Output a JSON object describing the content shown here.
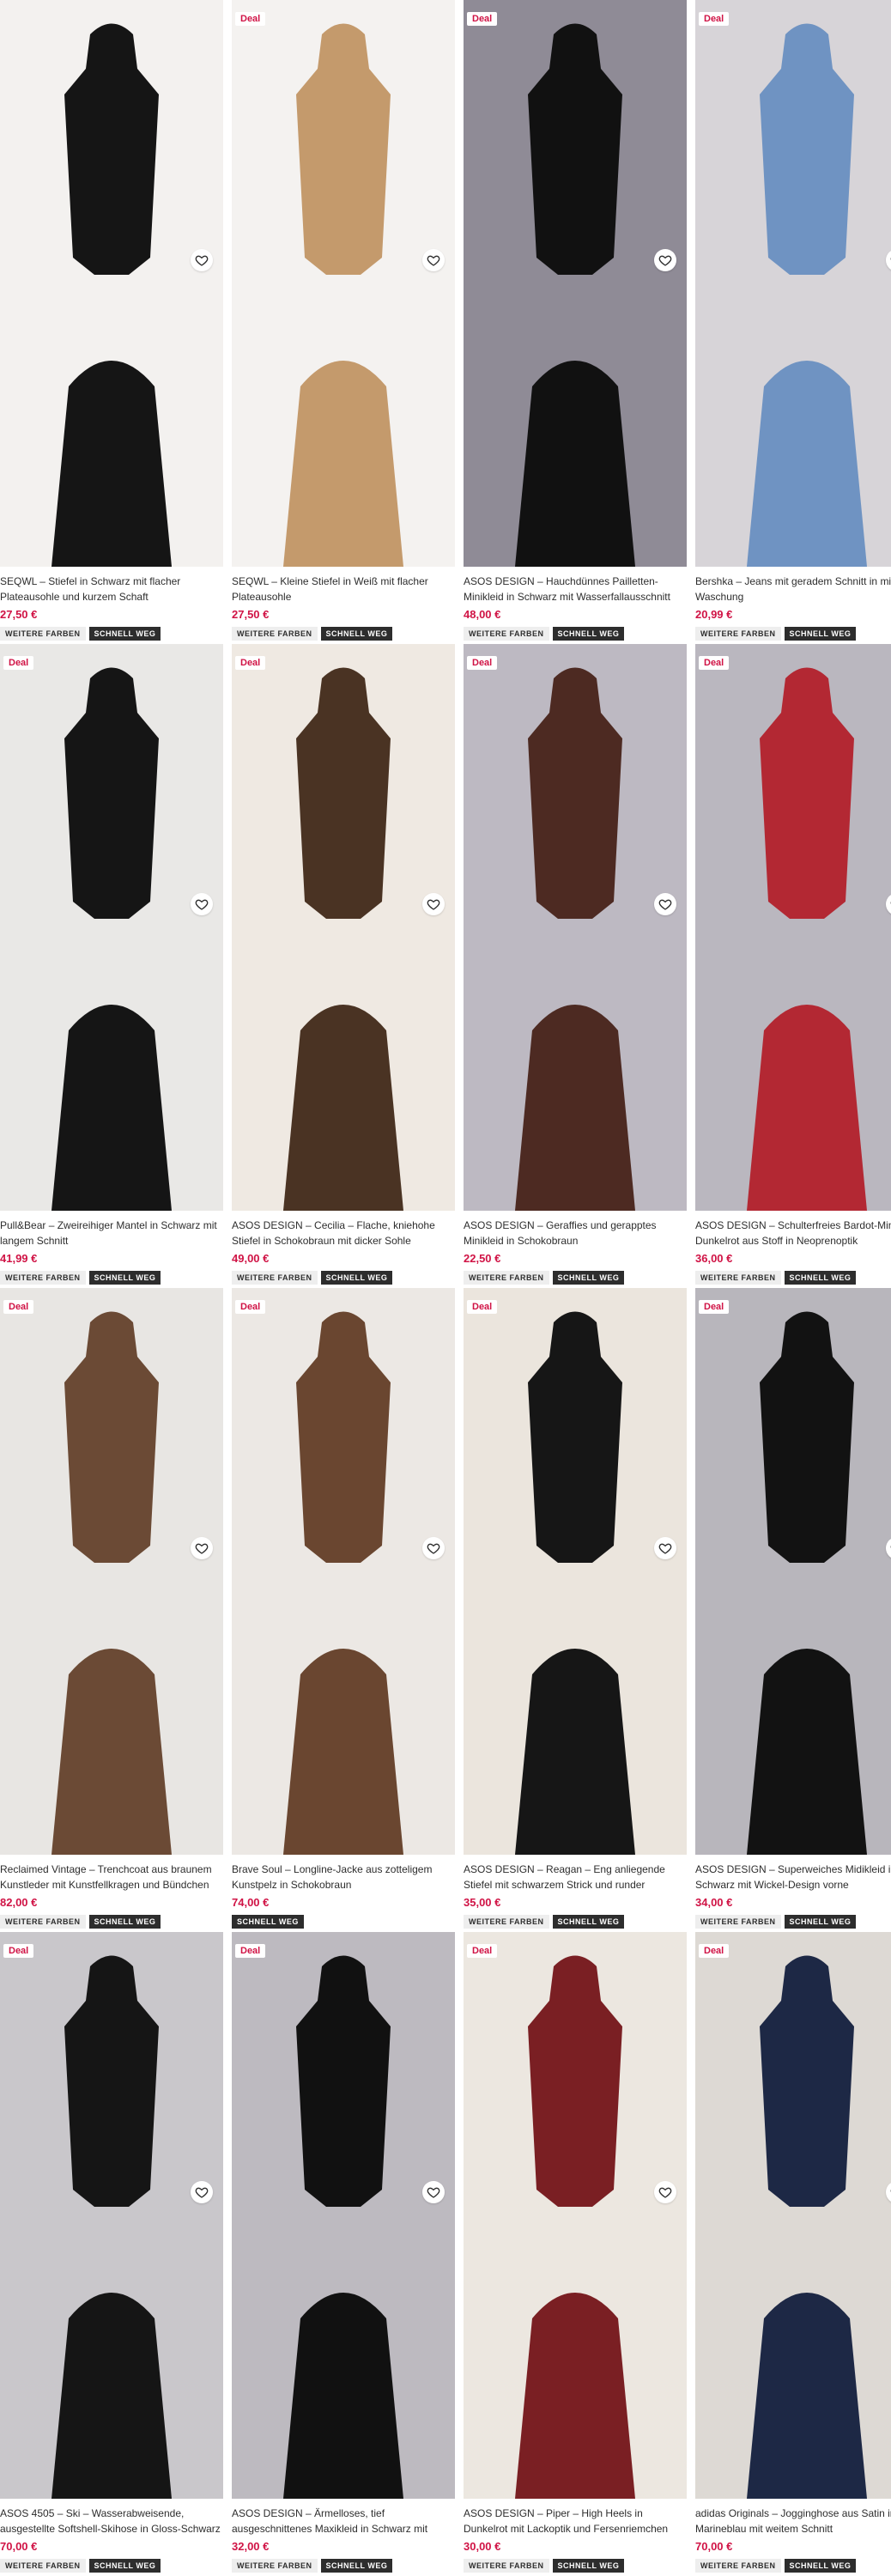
{
  "deal_label": "Deal",
  "products": [
    {
      "title": "SEQWL – Stiefel in Schwarz mit flacher Plateausohle und kurzem Schaft",
      "price": "27,50 €",
      "deal": false,
      "badges": [
        "WEITERE FARBEN",
        "SCHNELL WEG"
      ]
    },
    {
      "title": "SEQWL – Kleine Stiefel in Weiß mit flacher Plateausohle",
      "price": "27,50 €",
      "deal": true,
      "badges": [
        "WEITERE FARBEN",
        "SCHNELL WEG"
      ]
    },
    {
      "title": "ASOS DESIGN – Hauchdünnes Pailletten-Minikleid in Schwarz mit Wasserfallausschnitt und Riemchen-...",
      "price": "48,00 €",
      "deal": true,
      "badges": [
        "WEITERE FARBEN",
        "SCHNELL WEG"
      ]
    },
    {
      "title": "Bershka – Jeans mit geradem Schnitt in mittlerer Waschung",
      "price": "20,99 €",
      "deal": true,
      "badges": [
        "WEITERE FARBEN",
        "SCHNELL WEG"
      ]
    },
    {
      "title": "Pull&Bear – Zweireihiger Mantel in Schwarz mit langem Schnitt",
      "price": "41,99 €",
      "deal": true,
      "badges": [
        "WEITERE FARBEN",
        "SCHNELL WEG"
      ]
    },
    {
      "title": "ASOS DESIGN – Cecilia – Flache, kniehohe Stiefel in Schokobraun mit dicker Sohle",
      "price": "49,00 €",
      "deal": true,
      "badges": [
        "WEITERE FARBEN",
        "SCHNELL WEG"
      ]
    },
    {
      "title": "ASOS DESIGN – Geraffies und gerapptes Minikleid in Schokobraun",
      "price": "22,50 €",
      "deal": true,
      "badges": [
        "WEITERE FARBEN",
        "SCHNELL WEG"
      ]
    },
    {
      "title": "ASOS DESIGN – Schulterfreies Bardot-Minikleid Dunkelrot aus Stoff in Neoprenoptik",
      "price": "36,00 €",
      "deal": true,
      "badges": [
        "WEITERE FARBEN",
        "SCHNELL WEG"
      ]
    },
    {
      "title": "Reclaimed Vintage – Trenchcoat aus braunem Kunstleder mit Kunstfellkragen und Bündchen aus...",
      "price": "82,00 €",
      "deal": true,
      "badges": [
        "WEITERE FARBEN",
        "SCHNELL WEG"
      ]
    },
    {
      "title": "Brave Soul – Longline-Jacke aus zotteligem Kunstpelz in Schokobraun",
      "price": "74,00 €",
      "deal": true,
      "badges": [
        "SCHNELL WEG"
      ]
    },
    {
      "title": "ASOS DESIGN – Reagan – Eng anliegende Stiefel mit schwarzem Strick und runder Zehenpartie",
      "price": "35,00 €",
      "deal": true,
      "badges": [
        "WEITERE FARBEN",
        "SCHNELL WEG"
      ]
    },
    {
      "title": "ASOS DESIGN – Superweiches Midikleid in Schwarz mit Wickel-Design vorne",
      "price": "34,00 €",
      "deal": true,
      "badges": [
        "WEITERE FARBEN",
        "SCHNELL WEG"
      ]
    },
    {
      "title": "ASOS 4505 – Ski – Wasserabweisende, ausgestellte Softshell-Skihose in Gloss-Schwarz",
      "price": "70,00 €",
      "deal": true,
      "badges": [
        "WEITERE FARBEN",
        "SCHNELL WEG"
      ]
    },
    {
      "title": "ASOS DESIGN – Ärmelloses, tief ausgeschnittenes Maxikleid in Schwarz mit Raffung am Gesäß",
      "price": "32,00 €",
      "deal": true,
      "badges": [
        "WEITERE FARBEN",
        "SCHNELL WEG"
      ]
    },
    {
      "title": "ASOS DESIGN – Piper – High Heels in Dunkelrot mit Lackoptik und Fersenriemchen",
      "price": "30,00 €",
      "deal": true,
      "badges": [
        "WEITERE FARBEN",
        "SCHNELL WEG"
      ]
    },
    {
      "title": "adidas Originals – Jogginghose aus Satin in Marineblau mit weitem Schnitt",
      "price": "70,00 €",
      "deal": true,
      "badges": [
        "WEITERE FARBEN",
        "SCHNELL WEG"
      ]
    }
  ],
  "colors": {
    "price": "#d01345",
    "accent": "#2d2d2d"
  }
}
